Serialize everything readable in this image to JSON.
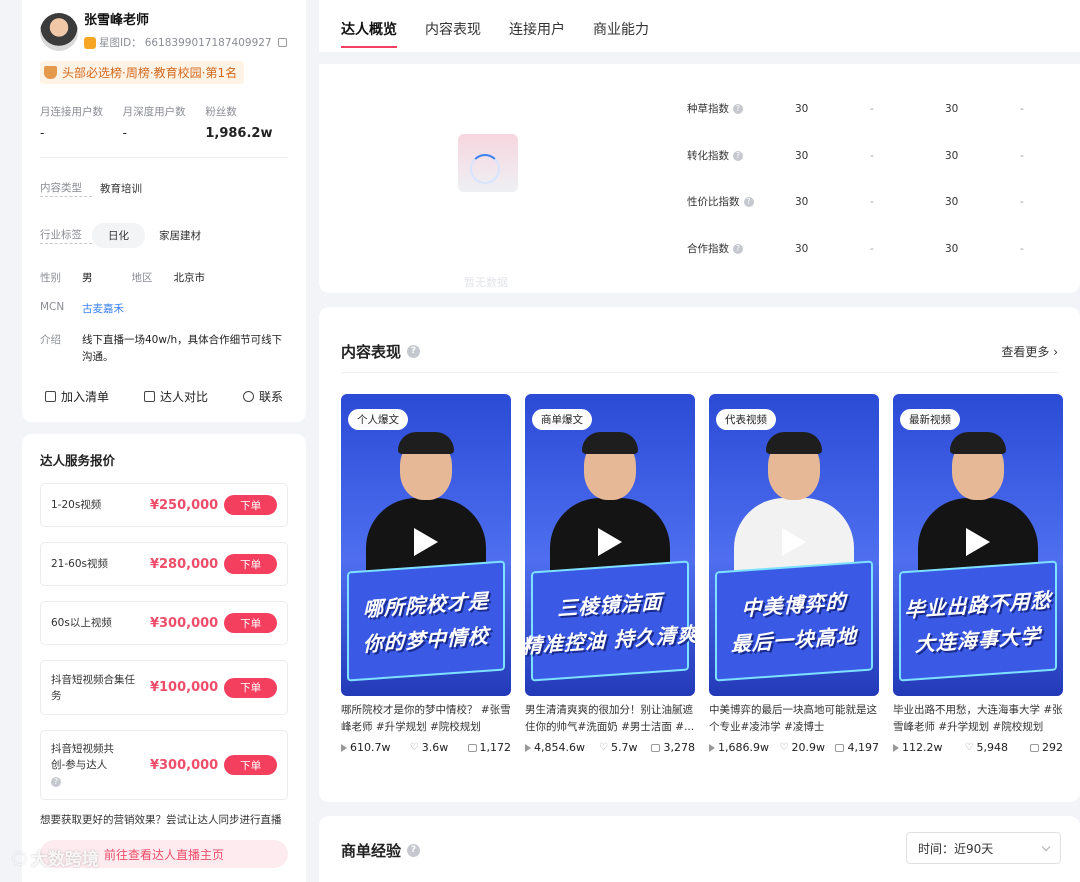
{
  "profile": {
    "name": "张雪峰老师",
    "id_label": "星图ID：",
    "id_value": "6618399017187409927",
    "rank": "头部必选榜·周榜·教育校园·第1名",
    "stats": [
      {
        "label": "月连接用户数",
        "value": "-"
      },
      {
        "label": "月深度用户数",
        "value": "-"
      },
      {
        "label": "粉丝数",
        "value": "1,986.2w"
      }
    ],
    "content_type_label": "内容类型",
    "content_type": "教育培训",
    "industry_label": "行业标签",
    "industry_tags": [
      "日化",
      "家居建材"
    ],
    "gender_label": "性别",
    "gender": "男",
    "region_label": "地区",
    "region": "北京市",
    "mcn_label": "MCN",
    "mcn": "古麦嘉禾",
    "intro_label": "介绍",
    "intro": "线下直播一场40w/h，具体合作细节可线下沟通。",
    "actions": [
      "加入清单",
      "达人对比",
      "联系"
    ]
  },
  "pricing": {
    "title": "达人服务报价",
    "items": [
      {
        "name": "1-20s视频",
        "price": "¥250,000"
      },
      {
        "name": "21-60s视频",
        "price": "¥280,000"
      },
      {
        "name": "60s以上视频",
        "price": "¥300,000"
      },
      {
        "name": "抖音短视频合集任务",
        "price": "¥100,000"
      },
      {
        "name": "抖音短视频共创-参与达人",
        "price": "¥300,000"
      }
    ],
    "order_label": "下单",
    "tip": "想要获取更好的营销效果？尝试让达人同步进行直播",
    "live_button": "前往查看达人直播主页"
  },
  "tabs": [
    "达人概览",
    "内容表现",
    "连接用户",
    "商业能力"
  ],
  "overview": {
    "empty_text": "暂无数据",
    "metrics": [
      {
        "name": "种草指数",
        "v1": "30",
        "d1": "-",
        "v2": "30",
        "d2": "-"
      },
      {
        "name": "转化指数",
        "v1": "30",
        "d1": "-",
        "v2": "30",
        "d2": "-"
      },
      {
        "name": "性价比指数",
        "v1": "30",
        "d1": "-",
        "v2": "30",
        "d2": "-"
      },
      {
        "name": "合作指数",
        "v1": "30",
        "d1": "-",
        "v2": "30",
        "d2": "-"
      }
    ]
  },
  "content": {
    "title": "内容表现",
    "more": "查看更多",
    "videos": [
      {
        "badge": "个人爆文",
        "caption1": "哪所院校才是",
        "caption2": "你的梦中情校",
        "title": "哪所院校才是你的梦中情校？ #张雪峰老师 #升学规划 #院校规划",
        "plays": "610.7w",
        "likes": "3.6w",
        "comments": "1,172",
        "shirt": "black"
      },
      {
        "badge": "商单爆文",
        "caption1": "三棱镜洁面",
        "caption2": "精准控油 持久清爽",
        "title": "男生清清爽爽的很加分！别让油腻遮住你的帅气#洗面奶 #男士洁面 #...",
        "plays": "4,854.6w",
        "likes": "5.7w",
        "comments": "3,278",
        "shirt": "black"
      },
      {
        "badge": "代表视频",
        "caption1": "中美博弈的",
        "caption2": "最后一块高地",
        "title": "中美博弈的最后一块高地可能就是这个专业#凌沛学 #凌博士",
        "plays": "1,686.9w",
        "likes": "20.9w",
        "comments": "4,197",
        "shirt": "white"
      },
      {
        "badge": "最新视频",
        "caption1": "毕业出路不用愁",
        "caption2": "大连海事大学",
        "title": "毕业出路不用愁，大连海事大学 #张雪峰老师 #升学规划 #院校规划",
        "plays": "112.2w",
        "likes": "5,948",
        "comments": "292",
        "shirt": "black"
      }
    ]
  },
  "deals": {
    "title": "商单经验",
    "time_label": "时间：",
    "time_value": "近90天"
  },
  "watermark": "大数跨境"
}
